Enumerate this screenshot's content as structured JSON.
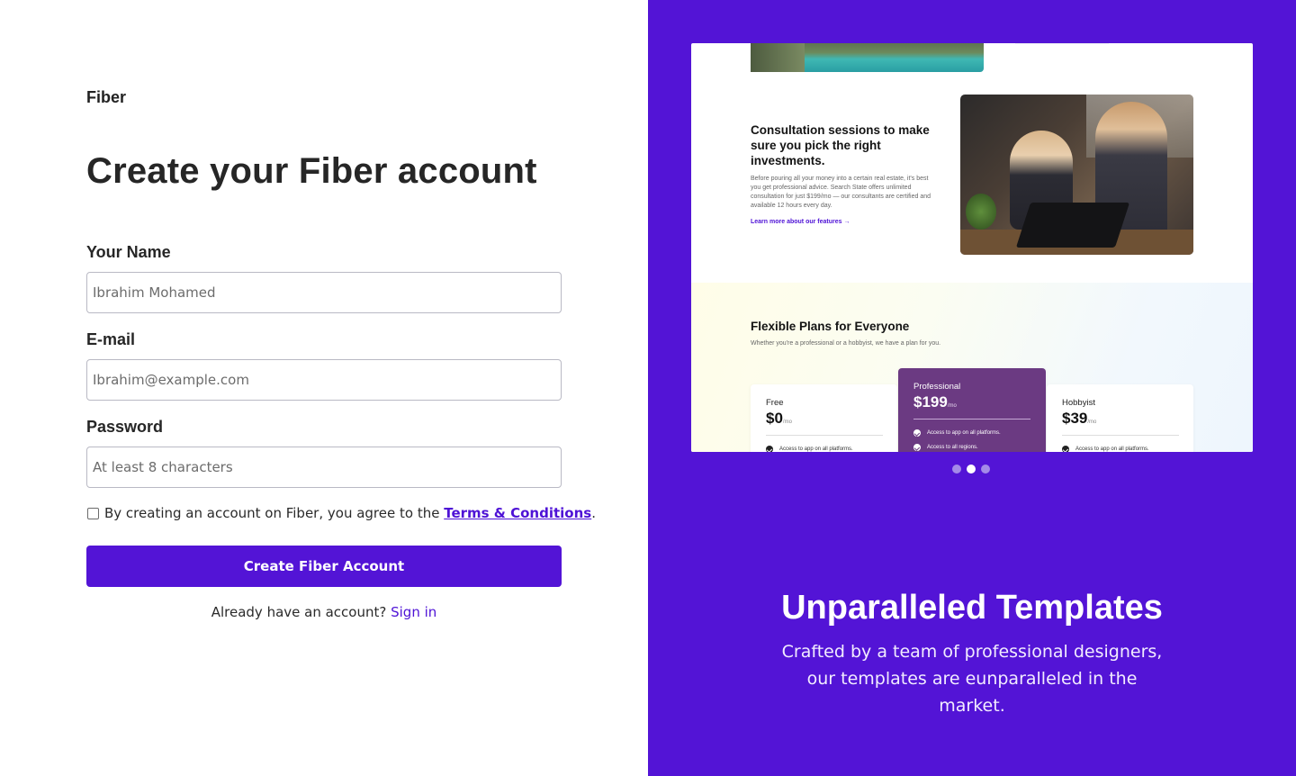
{
  "brand": "Fiber",
  "form": {
    "title": "Create your Fiber account",
    "name_label": "Your Name",
    "name_placeholder": "Ibrahim Mohamed",
    "email_label": "E-mail",
    "email_placeholder": "Ibrahim@example.com",
    "password_label": "Password",
    "password_placeholder": "At least 8 characters",
    "agree_prefix": "By creating an account on Fiber, you agree to the ",
    "terms_link": "Terms & Conditions",
    "agree_suffix": ".",
    "submit_label": "Create Fiber Account",
    "already_text": "Already have an account? ",
    "signin_link": "Sign in"
  },
  "showcase": {
    "preview": {
      "consult_title": "Consultation sessions to make sure you pick the right investments.",
      "consult_body": "Before pouring all your money into a certain real estate, it's best you get professional advice. Search State offers unlimited consultation for just $199/mo — our consultants are certified and available 12 hours every day.",
      "consult_link": "Learn more about our features →",
      "plans_title": "Flexible Plans for Everyone",
      "plans_sub": "Whether you're a professional or a hobbyist, we have a plan for you.",
      "plans": [
        {
          "name": "Free",
          "price": "$0",
          "unit": "/mo",
          "features": [
            "Access to app on all platforms."
          ]
        },
        {
          "name": "Professional",
          "price": "$199",
          "unit": "/mo",
          "features": [
            "Access to app on all platforms.",
            "Access to all regions."
          ]
        },
        {
          "name": "Hobbyist",
          "price": "$39",
          "unit": "/mo",
          "features": [
            "Access to app on all platforms."
          ]
        }
      ]
    },
    "carousel": {
      "count": 3,
      "active_index": 1
    },
    "title": "Unparalleled Templates",
    "subtitle": "Crafted by a team of professional designers, our templates are eunparalleled in the market."
  },
  "colors": {
    "accent": "#5314d6",
    "link": "#4e12d6",
    "pro_card": "#6b3a82"
  }
}
